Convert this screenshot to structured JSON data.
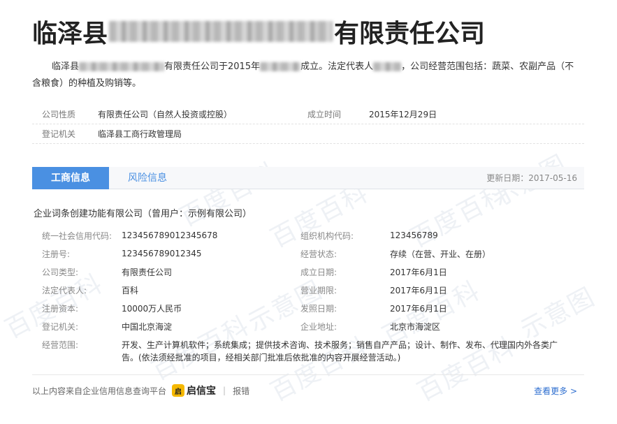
{
  "title": {
    "prefix": "临泽县",
    "suffix": "有限责任公司"
  },
  "intro": {
    "prefix": "临泽县",
    "part1": "有限责任公司于2015年",
    "part2": "成立。法定代表人",
    "part3": "，公司经营范围包括：蔬菜、农副产品（不含粮食）的种植及购销等。"
  },
  "basic": {
    "company_type_label": "公司性质",
    "company_type_value": "有限责任公司（自然人投资或控股）",
    "founded_label": "成立时间",
    "founded_value": "2015年12月29日",
    "registrar_label": "登记机关",
    "registrar_value": "临泽县工商行政管理局"
  },
  "tabs": {
    "business": "工商信息",
    "risk": "风险信息",
    "update_date": "更新日期：2017-05-16"
  },
  "company_name": "企业词条创建功能有限公司（曾用户：示例有限公司）",
  "details": [
    {
      "k1": "统一社会信用代码:",
      "v1": "123456789012345678",
      "k2": "组织机构代码:",
      "v2": "123456789"
    },
    {
      "k1": "注册号:",
      "v1": "123456789012345",
      "k2": "经营状态:",
      "v2": "存续（在营、开业、在册）"
    },
    {
      "k1": "公司类型:",
      "v1": "有限责任公司",
      "k2": "成立日期:",
      "v2": "2017年6月1日"
    },
    {
      "k1": "法定代表人:",
      "v1": "百科",
      "k2": "营业期限:",
      "v2": "2017年6月1日"
    },
    {
      "k1": "注册资本:",
      "v1": "10000万人民币",
      "k2": "发照日期:",
      "v2": "2017年6月1日"
    },
    {
      "k1": "登记机关:",
      "v1": "中国北京海淀",
      "k2": "企业地址:",
      "v2": "北京市海淀区"
    }
  ],
  "scope": {
    "label": "经营范围:",
    "value": "开发、生产计算机软件；系统集成；提供技术咨询、技术服务；销售自产产品；设计、制作、发布、代理国内外各类广告。(依法须经批准的项目，经相关部门批准后依批准的内容开展经营活动。)"
  },
  "footer": {
    "source": "以上内容来自企业信用信息查询平台",
    "logo_mark": "启",
    "logo_text": "启信宝",
    "separator": "|",
    "report": "报错",
    "more": "查看更多 >"
  },
  "watermark": {
    "a": "百度百科",
    "b": "示意图"
  },
  "colors": {
    "accent": "#4a90e2",
    "link": "#2f6fd0",
    "logo": "#f5b800"
  }
}
